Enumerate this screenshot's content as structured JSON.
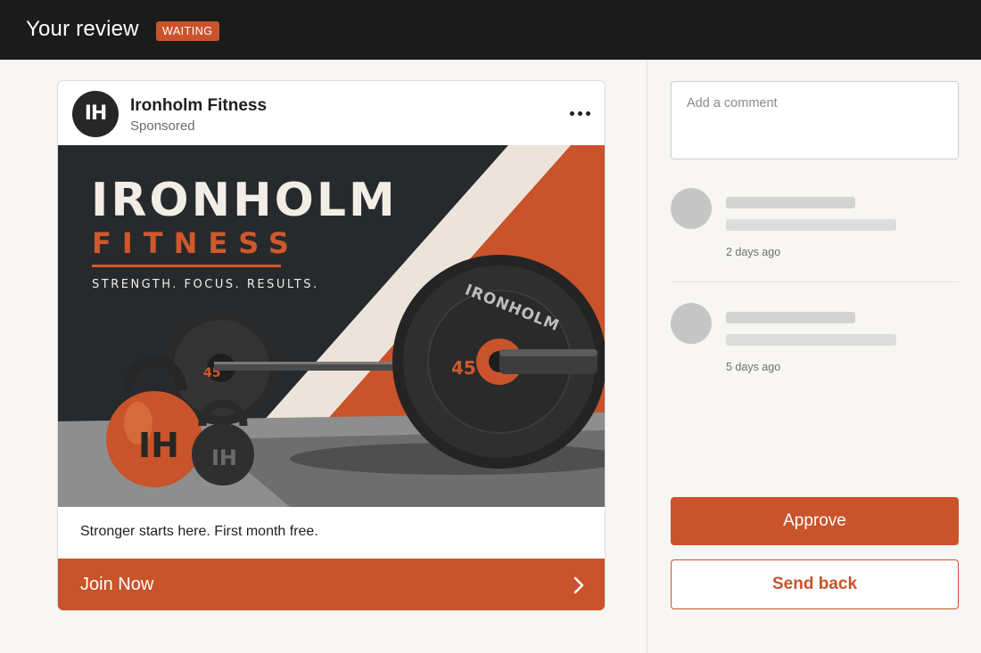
{
  "header": {
    "title": "Your review",
    "status_badge": "WAITING"
  },
  "ad": {
    "logo_text": "IH",
    "advertiser_name": "Ironholm Fitness",
    "sponsored_label": "Sponsored",
    "more_icon": "more-horizontal-icon",
    "image": {
      "brand_title": "IRONHOLM",
      "brand_subtitle": "FITNESS",
      "tagline": "STRENGTH. FOCUS. RESULTS.",
      "plate_text": "IRONHOLM",
      "plate_weight": "45",
      "kettlebell_logo": "IH"
    },
    "caption": "Stronger starts here. First month free.",
    "cta_label": "Join Now",
    "cta_icon": "chevron-right-icon"
  },
  "review_panel": {
    "comment_placeholder": "Add a comment",
    "comments": [
      {
        "time": "2 days ago"
      },
      {
        "time": "5 days ago"
      }
    ],
    "approve_label": "Approve",
    "send_back_label": "Send back"
  },
  "colors": {
    "accent": "#c9532a",
    "topbar": "#1b1b1b",
    "background": "#f7f6f3"
  }
}
